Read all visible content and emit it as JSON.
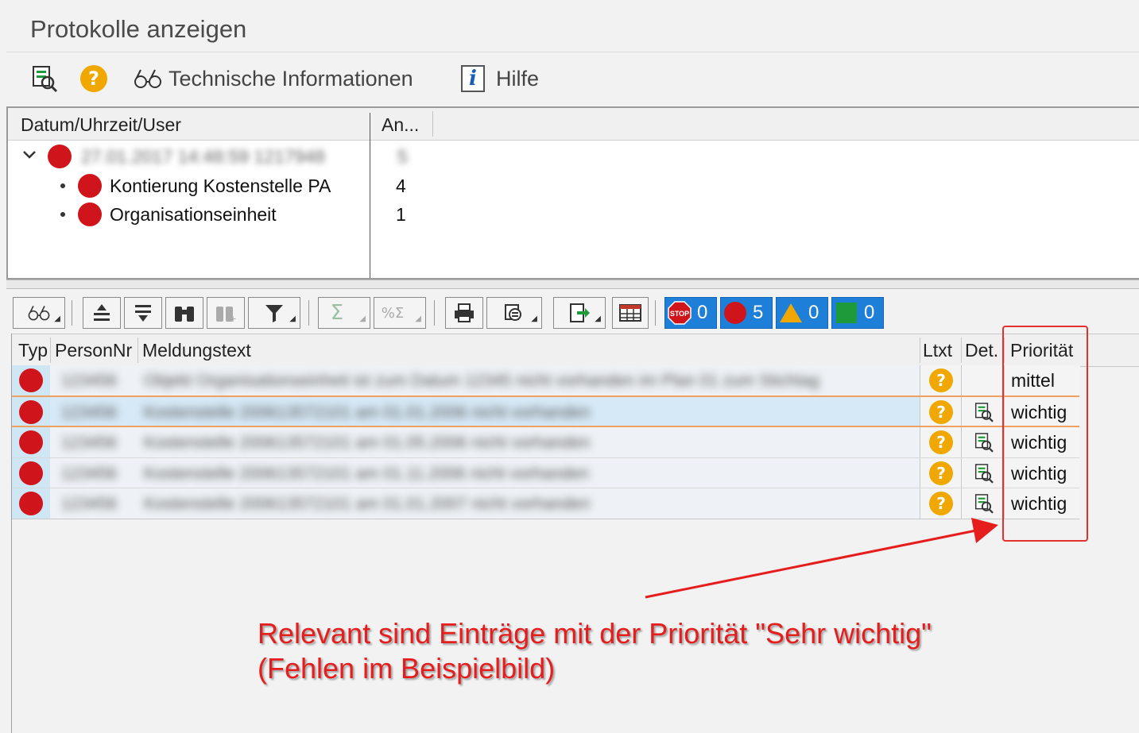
{
  "window": {
    "title": "Protokolle anzeigen"
  },
  "toolbar": {
    "technical_info_label": "Technische Informationen",
    "help_label": "Hilfe"
  },
  "tree": {
    "columns": [
      "Datum/Uhrzeit/User",
      "An..."
    ],
    "root": {
      "label": "27.01.2017 14:48:59 1217948",
      "count": "5"
    },
    "children": [
      {
        "label": "Kontierung Kostenstelle PA",
        "count": "4"
      },
      {
        "label": "Organisationseinheit",
        "count": "1"
      }
    ]
  },
  "alv_toolbar": {
    "counters": [
      {
        "icon": "stop-icon",
        "value": "0"
      },
      {
        "icon": "error-icon",
        "value": "5"
      },
      {
        "icon": "warning-icon",
        "value": "0"
      },
      {
        "icon": "success-icon",
        "value": "0"
      }
    ]
  },
  "grid": {
    "columns": [
      "Typ",
      "PersonNr",
      "Meldungstext",
      "Ltxt",
      "Det.",
      "Priorität"
    ],
    "rows": [
      {
        "person": "123456",
        "text": "Objekt Organisationseinheit ist zum Datum 12345 nicht vorhanden im Plan 01 zum Stichtag",
        "priority": "mittel"
      },
      {
        "person": "123456",
        "text": "Kostenstelle 200613572101 am 01.01.2006 nicht vorhanden",
        "priority": "wichtig"
      },
      {
        "person": "123456",
        "text": "Kostenstelle 200613572101 am 01.05.2006 nicht vorhanden",
        "priority": "wichtig"
      },
      {
        "person": "123456",
        "text": "Kostenstelle 200613572101 am 01.11.2006 nicht vorhanden",
        "priority": "wichtig"
      },
      {
        "person": "123456",
        "text": "Kostenstelle 200613572101 am 01.01.2007 nicht vorhanden",
        "priority": "wichtig"
      }
    ]
  },
  "annotation": {
    "line1": "Relevant sind Einträge mit der Priorität \"Sehr wichtig\"",
    "line2": "(Fehlen im Beispielbild)",
    "color": "#e51d1d"
  },
  "colors": {
    "error": "#d0141c",
    "question": "#f0a800",
    "counter_bg": "#1e7fd8",
    "typ_cell": "#cfe6f5"
  }
}
